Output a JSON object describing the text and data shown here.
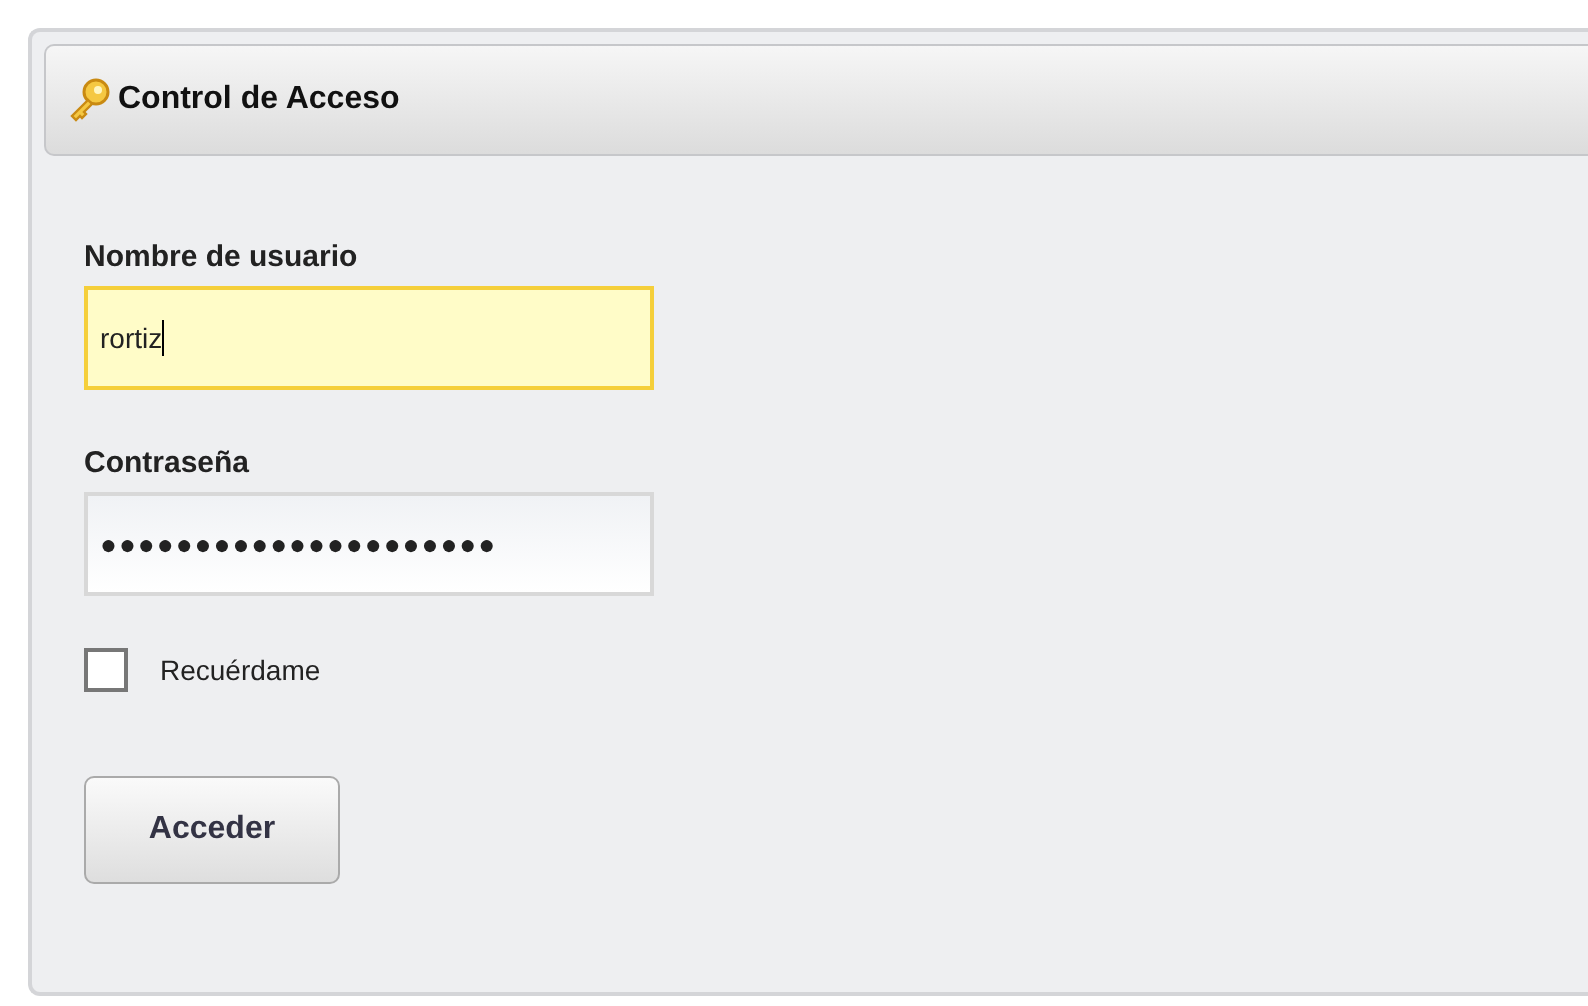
{
  "panel": {
    "title": "Control de Acceso"
  },
  "fields": [
    {
      "label": "Nombre de usuario",
      "value": "rortiz",
      "focused": true
    },
    {
      "label": "Contraseña",
      "value": "●●●●●●●●●●●●●●●●●●●●●",
      "focused": false
    }
  ],
  "remember": {
    "label": "Recuérdame",
    "checked": false
  },
  "buttons": [
    "Acceder"
  ]
}
